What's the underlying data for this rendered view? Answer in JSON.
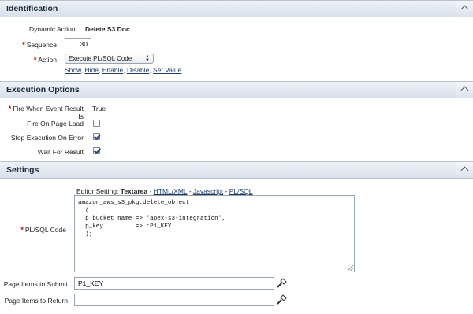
{
  "identification": {
    "title": "Identification",
    "dynamic_action_label": "Dynamic Action:",
    "dynamic_action_value": "Delete S3 Doc",
    "sequence_label": "Sequence",
    "sequence_value": "30",
    "action_label": "Action",
    "action_value": "Execute PL/SQL Code",
    "action_links": [
      "Show",
      "Hide",
      "Enable",
      "Disable",
      "Set Value"
    ]
  },
  "execution": {
    "title": "Execution Options",
    "fire_when_label": "Fire When Event Result Is",
    "fire_when_value": "True",
    "fire_on_load_label": "Fire On Page Load",
    "fire_on_load_checked": false,
    "stop_on_error_label": "Stop Execution On Error",
    "stop_on_error_checked": true,
    "wait_for_result_label": "Wait For Result",
    "wait_for_result_checked": true
  },
  "settings": {
    "title": "Settings",
    "editor_setting_prefix": "Editor Setting:",
    "editor_setting_value": "Textarea",
    "editor_links": [
      "HTML/XML",
      "Javascript",
      "PL/SQL"
    ],
    "plsql_label": "PL/SQL Code",
    "plsql_code": "amazon_aws_s3_pkg.delete_object\n  (\n  p_bucket_name => 'apex-s3-integration',\n  p_key         => :P1_KEY\n  );",
    "items_to_submit_label": "Page Items to Submit",
    "items_to_submit_value": "P1_KEY",
    "items_to_return_label": "Page Items to Return",
    "items_to_return_value": ""
  },
  "colors": {
    "required": "#cc0000",
    "link": "#1f3a66",
    "header_bg": "#dde3eb"
  },
  "icons": {
    "collapse": "chevron-up-icon",
    "picker": "flashlight-icon"
  }
}
